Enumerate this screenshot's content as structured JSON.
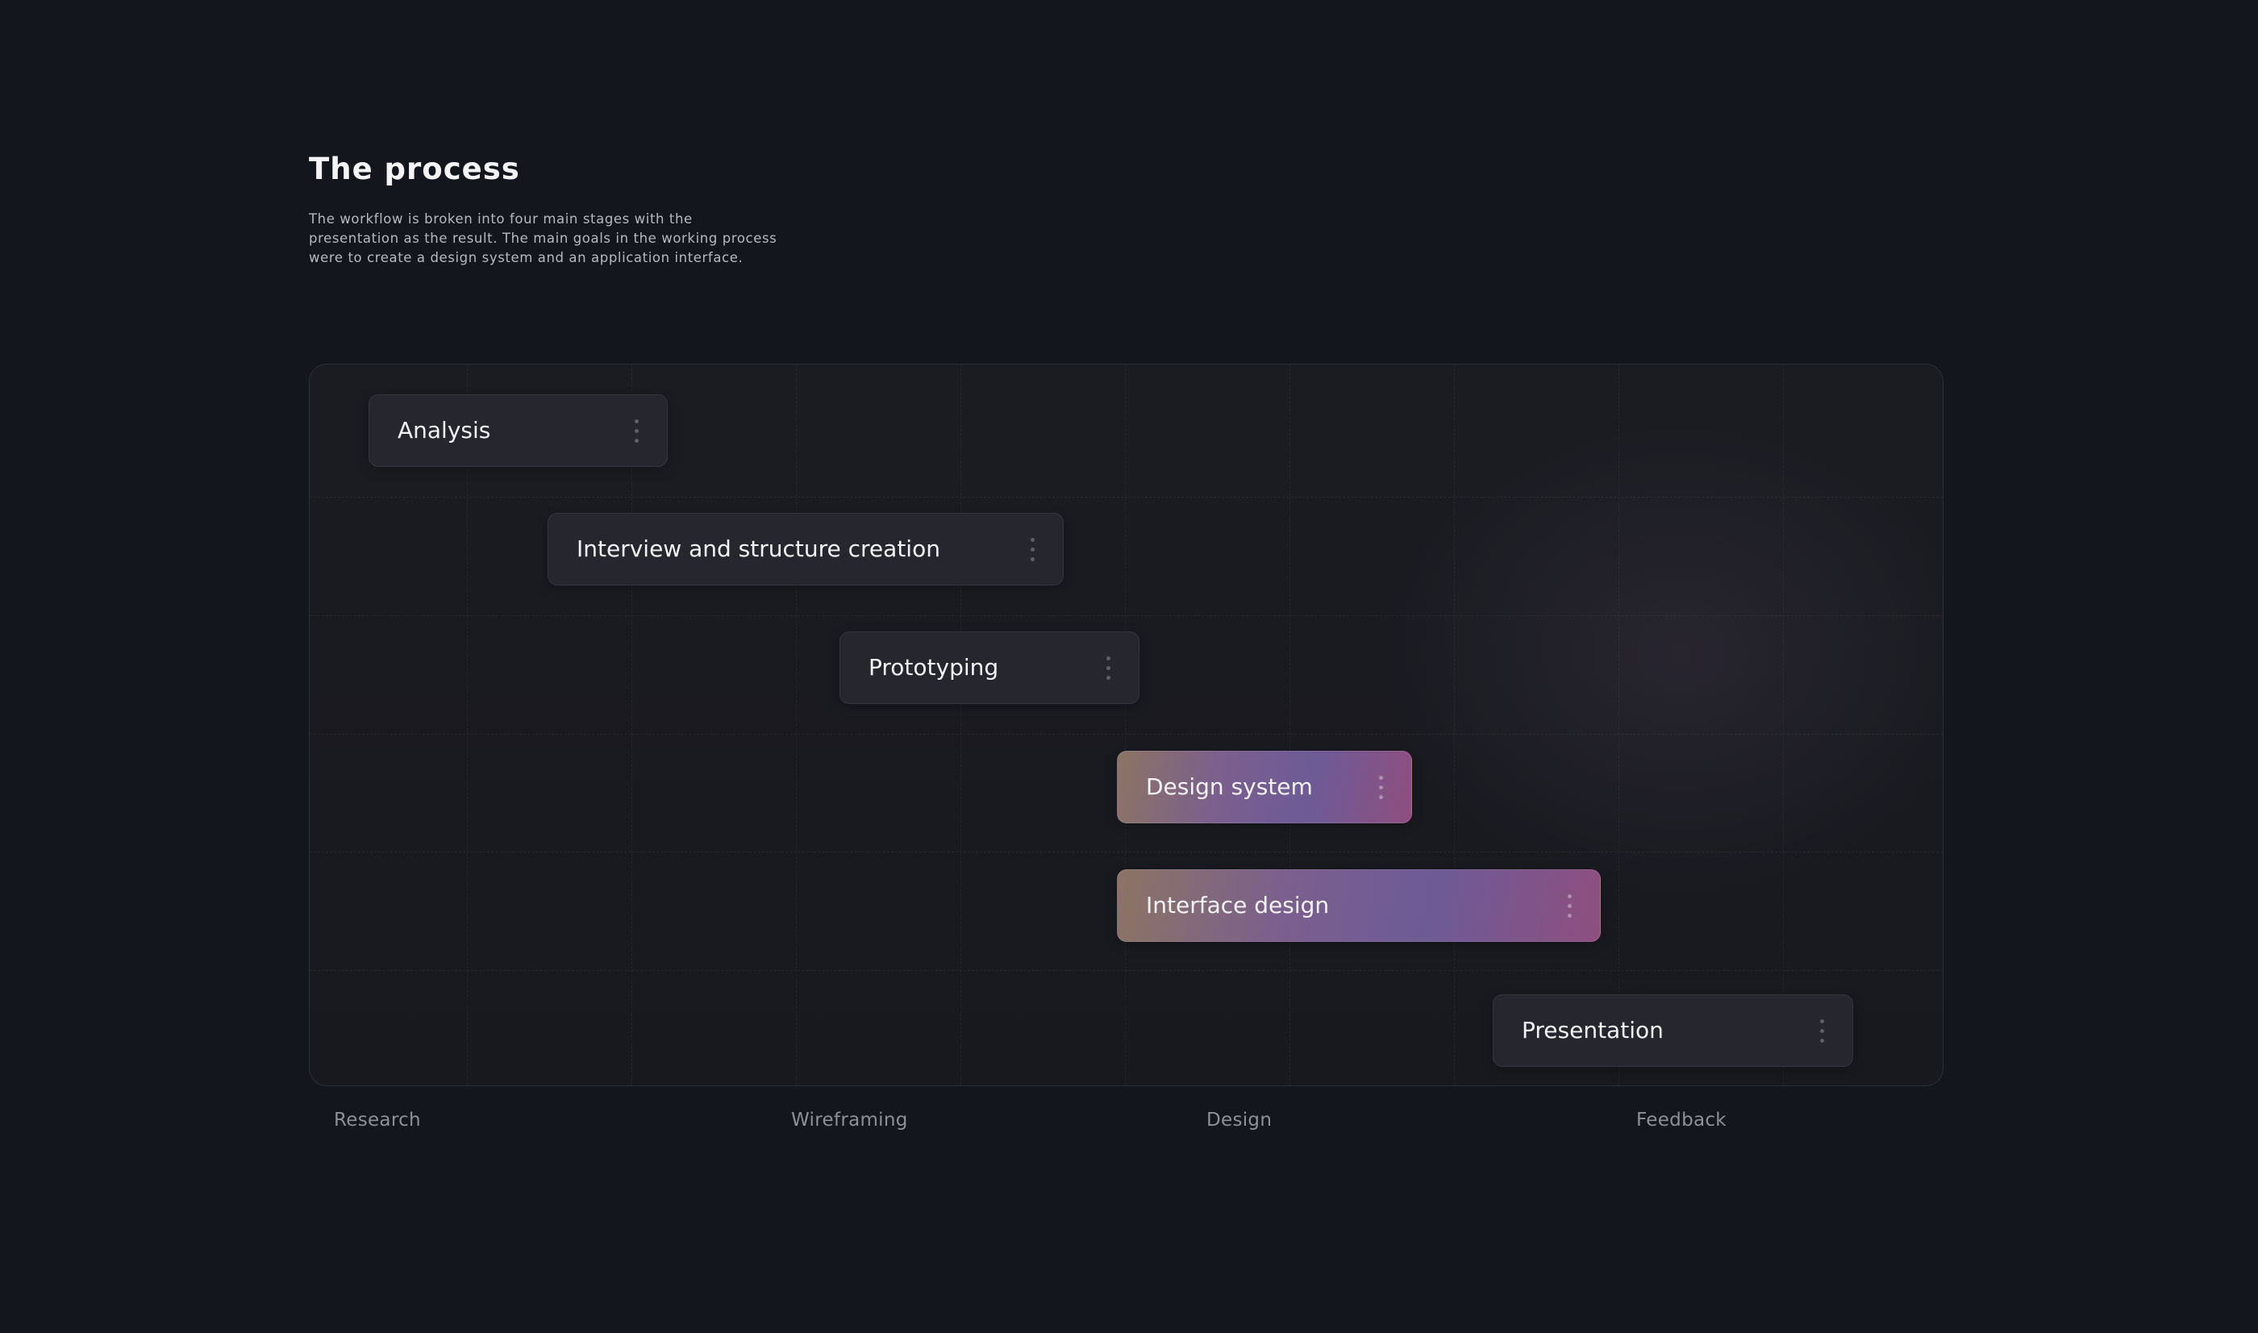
{
  "header": {
    "title": "The process",
    "description_lines": [
      "The workflow is broken into four main stages with the",
      "presentation as the result. The main goals in the working process",
      "were to create a design system and an application interface."
    ]
  },
  "chart_data": {
    "type": "gantt",
    "tasks": [
      {
        "name": "Analysis",
        "highlighted": false
      },
      {
        "name": "Interview and structure creation",
        "highlighted": false
      },
      {
        "name": "Prototyping",
        "highlighted": false
      },
      {
        "name": "Design system",
        "highlighted": true
      },
      {
        "name": "Interface design",
        "highlighted": true
      },
      {
        "name": "Presentation",
        "highlighted": false
      }
    ],
    "phases": [
      "Research",
      "Wireframing",
      "Design",
      "Feedback"
    ],
    "colors": {
      "background": "#14161d",
      "task": "#25262e",
      "highlight_gradient": [
        "#8c7464",
        "#7b5f8e",
        "#6d5b96",
        "#8e4f7e"
      ]
    }
  }
}
